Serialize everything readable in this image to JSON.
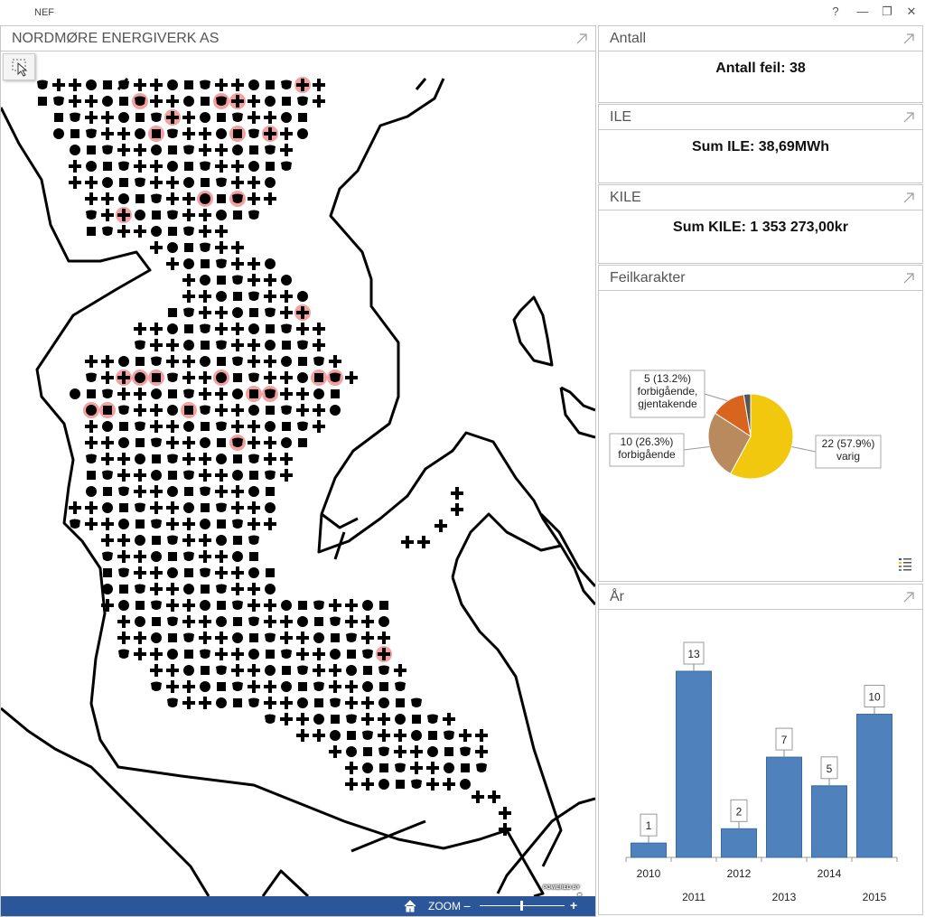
{
  "window": {
    "title": "NEF",
    "help": "?",
    "minimize": "—",
    "restore": "❐",
    "close": "✕"
  },
  "map": {
    "title": "NORDMØRE ENERGIVERK AS",
    "zoom_label": "ZOOM",
    "zoom_minus": "−",
    "zoom_plus": "+",
    "zoom_level": 0.48,
    "attribution_top": "POWERED BY",
    "attribution": "esri"
  },
  "antall": {
    "title": "Antall",
    "value": "Antall feil: 38"
  },
  "ile": {
    "title": "ILE",
    "value": "Sum ILE: 38,69MWh"
  },
  "kile": {
    "title": "KILE",
    "value": "Sum KILE: 1 353 273,00kr"
  },
  "feilkarakter": {
    "title": "Feilkarakter",
    "chart_data": {
      "type": "pie",
      "slices": [
        {
          "label": "varig",
          "value": 22,
          "text": "22 (57.9%)",
          "color": "#f2c80f"
        },
        {
          "label": "forbigående",
          "value": 10,
          "text": "10 (26.3%)",
          "color": "#b88a5e"
        },
        {
          "label": "forbigående, gjentakende",
          "value": 5,
          "text": "5 (13.2%)",
          "color": "#d9641e"
        },
        {
          "label": "",
          "value": 1,
          "text": "",
          "color": "#555555"
        }
      ]
    }
  },
  "aar": {
    "title": "År",
    "chart_data": {
      "type": "bar",
      "categories": [
        "2010",
        "2011",
        "2012",
        "2013",
        "2014",
        "2015"
      ],
      "values": [
        1,
        13,
        2,
        7,
        5,
        10
      ],
      "color": "#4f81bd",
      "ylim": [
        0,
        13
      ]
    }
  }
}
